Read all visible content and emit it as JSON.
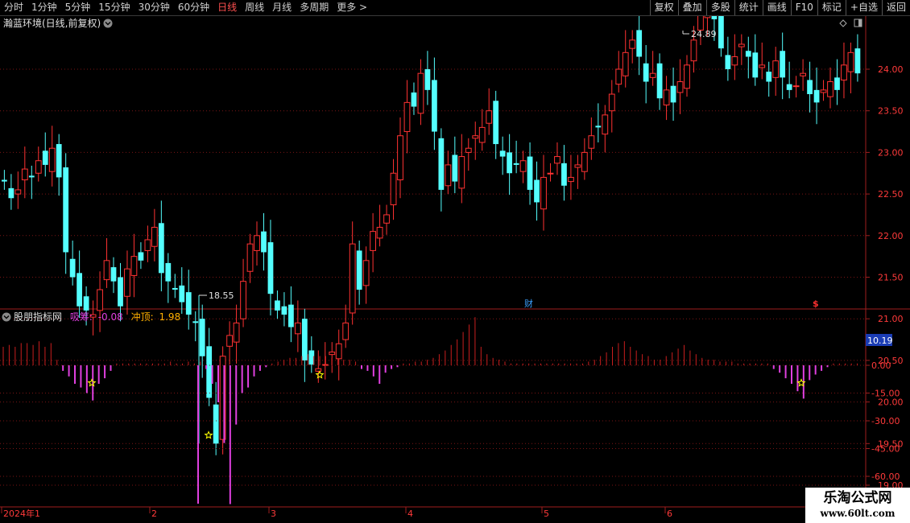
{
  "toolbar": {
    "tabs": [
      "分时",
      "1分钟",
      "5分钟",
      "15分钟",
      "30分钟",
      "60分钟",
      "日线",
      "周线",
      "月线",
      "多周期",
      "更多 >"
    ],
    "active": "日线",
    "right_tools": [
      "复权",
      "叠加",
      "多股",
      "统计",
      "画线",
      "F10",
      "标记",
      "+自选",
      "返回"
    ]
  },
  "main_chart": {
    "title": "瀚蓝环境(日线,前复权)",
    "high_label": "24.89",
    "low_label": "18.55",
    "y_ticks": [
      "24.00",
      "23.50",
      "23.00",
      "22.50",
      "22.00",
      "21.50",
      "21.00",
      "20.50",
      "20.00",
      "19.50",
      "19.00"
    ],
    "event_markers": [
      "财",
      "$"
    ],
    "icon_names": [
      "chevron-down-icon",
      "diamond-icon",
      "window-icon"
    ]
  },
  "indicator": {
    "name": "股朋指标网",
    "label1": "吸筹:",
    "value1": "-0.08",
    "label2": "冲顶:",
    "value2": "1.98",
    "y_ticks": [
      "0.00",
      "-15.00",
      "-30.00",
      "-45.00",
      "-60.00"
    ],
    "current_value": "10.19"
  },
  "x_axis": {
    "labels": [
      "2024年1",
      "2",
      "3",
      "4",
      "5",
      "6"
    ]
  },
  "colors": {
    "up": "#ff3232",
    "down": "#54ffff",
    "grid": "#8b1a1a",
    "indicator_pos": "#c81e1e",
    "indicator_neg": "#e040e0",
    "star": "#ffff00",
    "current_box": "#1a3cb4"
  },
  "watermark": {
    "title": "乐淘公式网",
    "url": "www.60lt.com"
  }
}
